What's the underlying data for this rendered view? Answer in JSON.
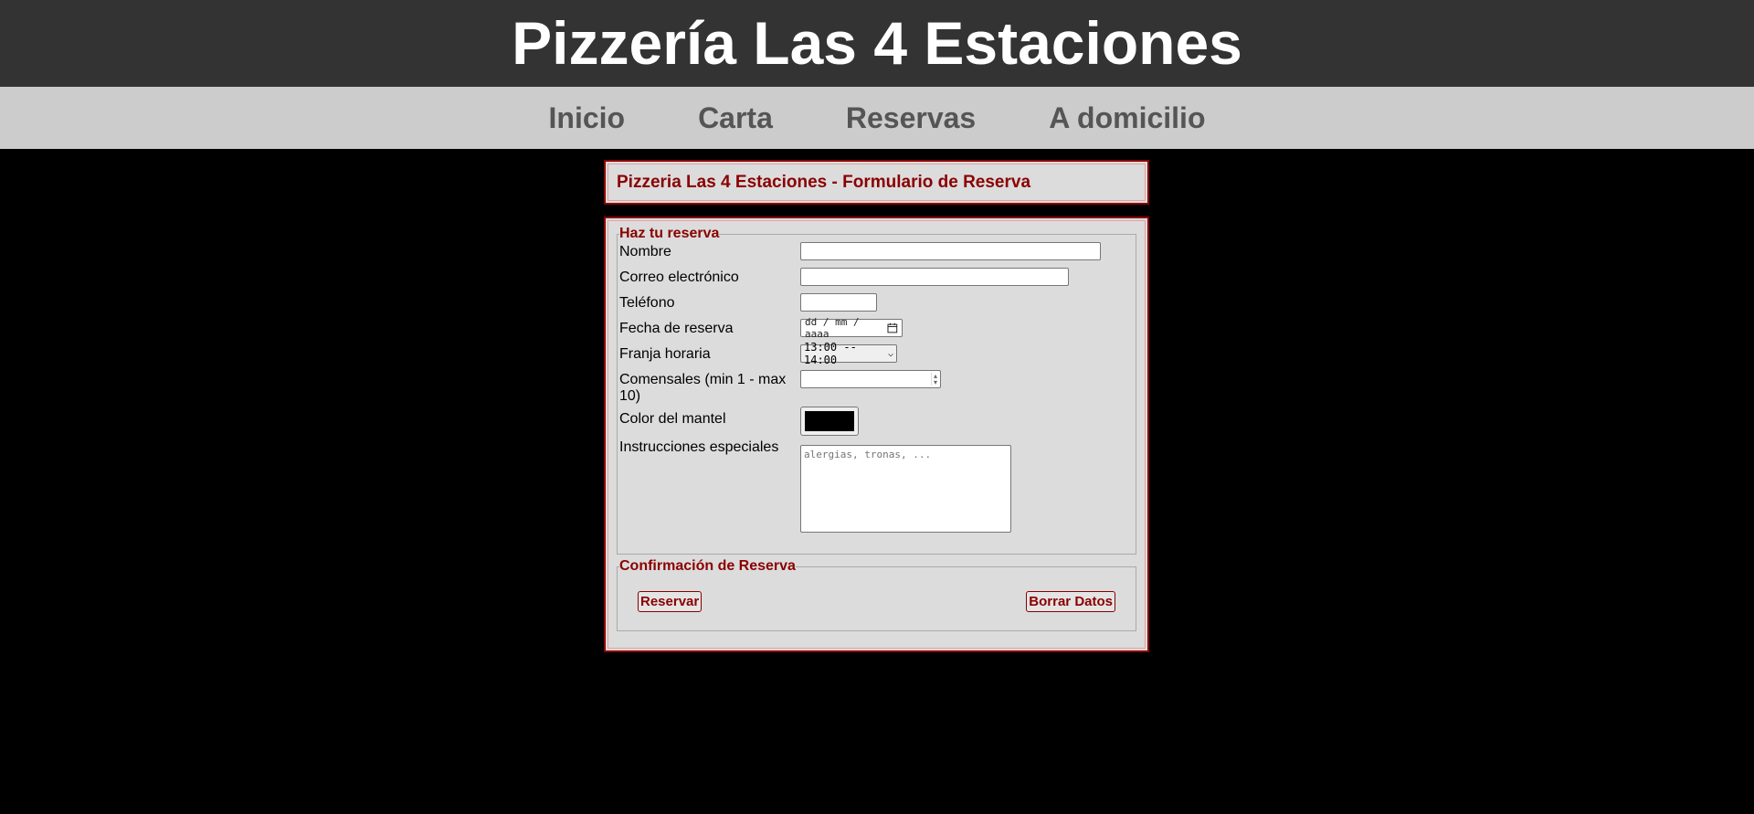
{
  "header": {
    "title": "Pizzería Las 4 Estaciones"
  },
  "nav": {
    "items": [
      {
        "label": "Inicio"
      },
      {
        "label": "Carta"
      },
      {
        "label": "Reservas"
      },
      {
        "label": "A domicilio"
      }
    ]
  },
  "form_title": "Pizzeria Las 4 Estaciones - Formulario de Reserva",
  "reservation": {
    "legend": "Haz tu reserva",
    "nombre_label": "Nombre",
    "nombre_value": "",
    "correo_label": "Correo electrónico",
    "correo_value": "",
    "telefono_label": "Teléfono",
    "telefono_value": "",
    "fecha_label": "Fecha de reserva",
    "fecha_placeholder": "dd / mm / aaaa",
    "franja_label": "Franja horaria",
    "franja_selected": "13:00 -- 14:00",
    "comensales_label": "Comensales (min 1 - max 10)",
    "comensales_value": "",
    "color_label": "Color del mantel",
    "color_value": "#000000",
    "instrucciones_label": "Instrucciones especiales",
    "instrucciones_placeholder": "alergias, tronas, ..."
  },
  "confirmation": {
    "legend": "Confirmación de Reserva",
    "submit_label": "Reservar",
    "reset_label": "Borrar Datos"
  },
  "colors": {
    "header_bg": "#333333",
    "nav_bg": "#cccccc",
    "accent": "#8b0000",
    "page_bg": "#000000"
  }
}
